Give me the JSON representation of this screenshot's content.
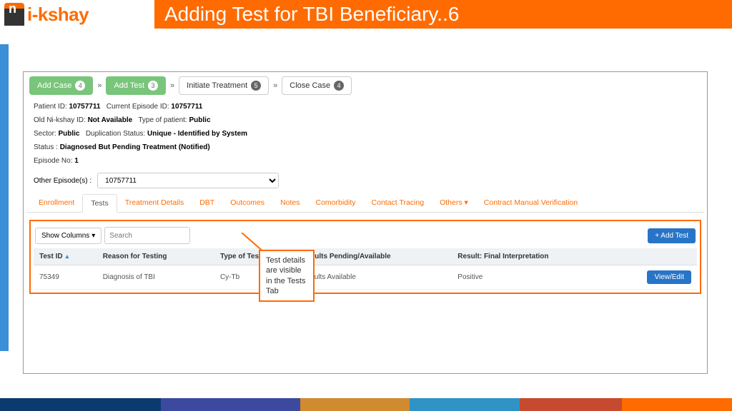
{
  "header": {
    "logo_text": "i-kshay",
    "title": "Adding Test for TBI Beneficiary..6"
  },
  "steps": {
    "add_case": "Add Case",
    "add_case_badge": "4",
    "add_test": "Add Test",
    "add_test_badge": "3",
    "initiate_treatment": "Initiate Treatment",
    "initiate_badge": "5",
    "close_case": "Close Case",
    "close_badge": "4"
  },
  "info": {
    "patient_id_label": "Patient ID:",
    "patient_id": "10757711",
    "current_episode_label": "Current Episode ID:",
    "current_episode": "10757711",
    "old_id_label": "Old Ni-kshay ID:",
    "old_id": "Not Available",
    "type_label": "Type of patient:",
    "type": "Public",
    "sector_label": "Sector:",
    "sector": "Public",
    "dup_label": "Duplication Status:",
    "dup": "Unique - Identified by System",
    "status_label": "Status :",
    "status": "Diagnosed But Pending Treatment (Notified)",
    "ep_no_label": "Episode No:",
    "ep_no": "1",
    "other_ep_label": "Other Episode(s) :",
    "other_ep_value": "10757711"
  },
  "tabs": {
    "enrollment": "Enrollment",
    "tests": "Tests",
    "treatment": "Treatment Details",
    "dbt": "DBT",
    "outcomes": "Outcomes",
    "notes": "Notes",
    "comorbidity": "Comorbidity",
    "contact": "Contact Tracing",
    "others": "Others",
    "contract": "Contract Manual Verification"
  },
  "toolbar": {
    "show_columns": "Show Columns",
    "search_placeholder": "Search",
    "add_test": "+ Add Test"
  },
  "columns": {
    "test_id": "Test ID",
    "reason": "Reason for Testing",
    "type": "Type of Test",
    "results_pending": "Results Pending/Available",
    "final": "Result: Final Interpretation"
  },
  "row": {
    "test_id": "75349",
    "reason": "Diagnosis of TBI",
    "type": "Cy-Tb",
    "results_pending": "Results Available",
    "final": "Positive",
    "action": "View/Edit"
  },
  "callout": "Test details are visible in the Tests Tab"
}
